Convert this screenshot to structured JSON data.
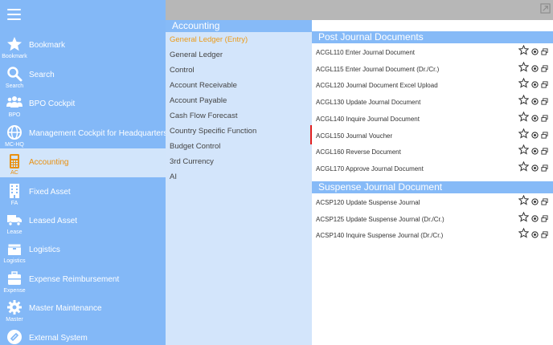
{
  "sidebar": {
    "items": [
      {
        "label": "Bookmark",
        "abbr": "Bookmark",
        "icon": "star-icon"
      },
      {
        "label": "Search",
        "abbr": "Search",
        "icon": "search-icon"
      },
      {
        "label": "BPO Cockpit",
        "abbr": "BPO",
        "icon": "people-icon"
      },
      {
        "label": "Management Cockpit for Headquarters",
        "abbr": "MC-HQ",
        "icon": "globe-icon"
      },
      {
        "label": "Accounting",
        "abbr": "AC",
        "icon": "calculator-icon"
      },
      {
        "label": "Fixed Asset",
        "abbr": "FA",
        "icon": "building-icon"
      },
      {
        "label": "Leased Asset",
        "abbr": "Lease",
        "icon": "truck-icon"
      },
      {
        "label": "Logistics",
        "abbr": "Logistics",
        "icon": "box-icon"
      },
      {
        "label": "Expense Reimbursement",
        "abbr": "Expense",
        "icon": "suitcase-icon"
      },
      {
        "label": "Master Maintenance",
        "abbr": "Master",
        "icon": "gear-icon"
      },
      {
        "label": "External System",
        "abbr": "",
        "icon": "link-icon"
      }
    ]
  },
  "middle": {
    "title": "Accounting",
    "items": [
      "General Ledger (Entry)",
      "General Ledger",
      "Control",
      "Account Receivable",
      "Account Payable",
      "Cash Flow Forecast",
      "Country Specific Function",
      "Budget Control",
      "3rd Currency",
      "AI"
    ],
    "active_index": 0
  },
  "right": {
    "sections": [
      {
        "title": "Post Journal Documents",
        "rows": [
          "ACGL110 Enter Journal Document",
          "ACGL115 Enter Journal Document (Dr./Cr.)",
          "ACGL120 Journal Document Excel Upload",
          "ACGL130 Update Journal Document",
          "ACGL140 Inquire Journal Document",
          "ACGL150 Journal Voucher",
          "ACGL160 Reverse Document",
          "ACGL170 Approve Journal Document"
        ]
      },
      {
        "title": "Suspense Journal Document",
        "rows": [
          "ACSP120 Update Suspense Journal",
          "ACSP125 Update Suspense Journal (Dr./Cr.)",
          "ACSP140 Inquire Suspense Journal (Dr./Cr.)"
        ]
      }
    ],
    "highlighted_row": "ACGL150 Journal Voucher"
  },
  "colors": {
    "sidebar_bg": "#83b8f7",
    "active_text": "#e9900f",
    "highlight_border": "#e12020"
  }
}
